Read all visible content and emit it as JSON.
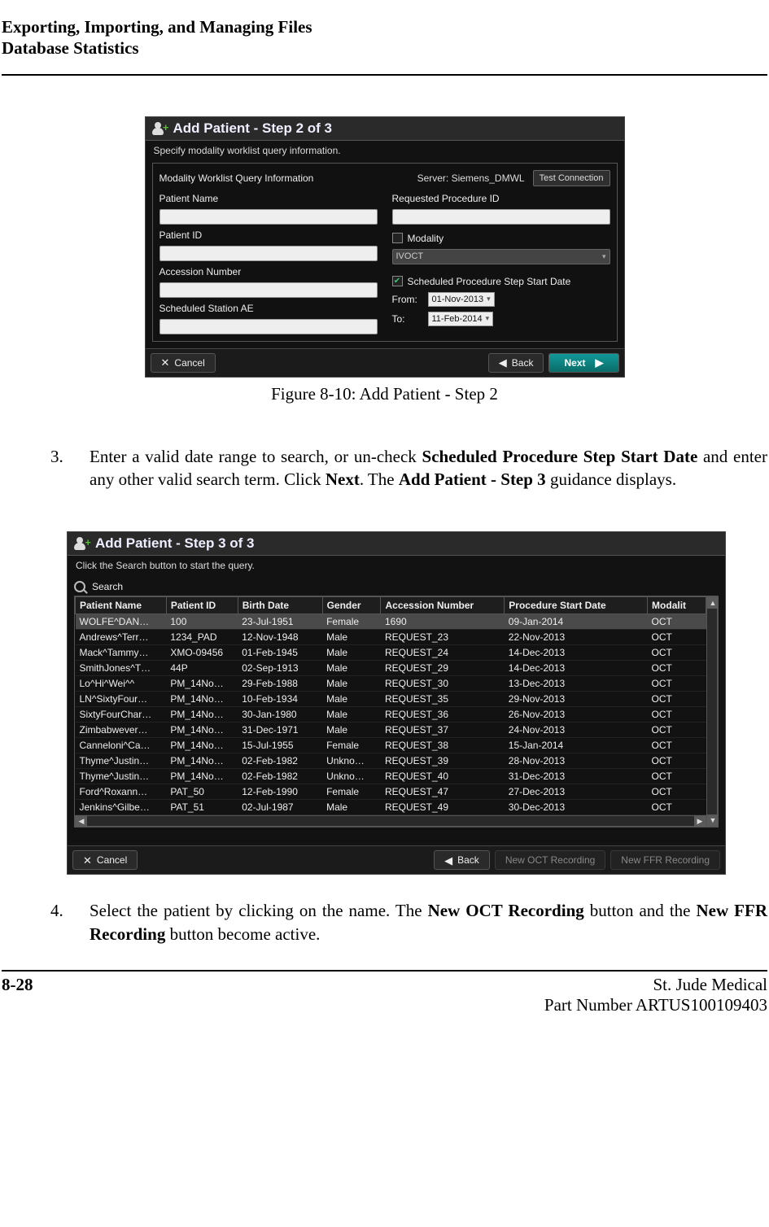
{
  "header": {
    "l1": "Exporting, Importing, and Managing Files",
    "l2": "Database Statistics"
  },
  "figure1": {
    "title": "Add Patient - Step 2 of 3",
    "subtitle": "Specify modality worklist query information.",
    "section": "Modality Worklist Query Information",
    "server": "Server: Siemens_DMWL",
    "test_connection": "Test Connection",
    "labels": {
      "patient_name": "Patient Name",
      "patient_id": "Patient ID",
      "accession": "Accession Number",
      "station_ae": "Scheduled Station AE",
      "req_proc": "Requested Procedure ID",
      "modality": "Modality",
      "modality_value": "IVOCT",
      "sched_date": "Scheduled Procedure Step Start Date",
      "from": "From:",
      "to": "To:",
      "from_val": "01-Nov-2013",
      "to_val": "11-Feb-2014"
    },
    "buttons": {
      "cancel": "Cancel",
      "back": "Back",
      "next": "Next"
    },
    "caption": "Figure 8-10:  Add Patient - Step 2"
  },
  "step3_text": {
    "num": "3.",
    "t1": "Enter a valid date range to search, or un-check ",
    "b1": "Scheduled Procedure Step Start Date",
    "t2": " and enter any other valid search term. Click ",
    "b2": "Next",
    "t3": ". The ",
    "b3": "Add Patient - Step 3",
    "t4": " guidance displays."
  },
  "figure2": {
    "title": "Add Patient - Step 3 of 3",
    "subtitle": "Click the Search button to start the query.",
    "search": "Search",
    "columns": [
      "Patient Name",
      "Patient ID",
      "Birth Date",
      "Gender",
      "Accession Number",
      "Procedure Start Date",
      "Modalit"
    ],
    "rows": [
      [
        "WOLFE^DAN…",
        "100",
        "23-Jul-1951",
        "Female",
        "1690",
        "09-Jan-2014",
        "OCT"
      ],
      [
        "Andrews^Terr…",
        "1234_PAD",
        "12-Nov-1948",
        "Male",
        "REQUEST_23",
        "22-Nov-2013",
        "OCT"
      ],
      [
        "Mack^Tammy…",
        "XMO-09456",
        "01-Feb-1945",
        "Male",
        "REQUEST_24",
        "14-Dec-2013",
        "OCT"
      ],
      [
        "SmithJones^T…",
        "44P",
        "02-Sep-1913",
        "Male",
        "REQUEST_29",
        "14-Dec-2013",
        "OCT"
      ],
      [
        "Lo^Hi^Wei^^",
        "PM_14No…",
        "29-Feb-1988",
        "Male",
        "REQUEST_30",
        "13-Dec-2013",
        "OCT"
      ],
      [
        "LN^SixtyFour…",
        "PM_14No…",
        "10-Feb-1934",
        "Male",
        "REQUEST_35",
        "29-Nov-2013",
        "OCT"
      ],
      [
        "SixtyFourChar…",
        "PM_14No…",
        "30-Jan-1980",
        "Male",
        "REQUEST_36",
        "26-Nov-2013",
        "OCT"
      ],
      [
        "Zimbabwever…",
        "PM_14No…",
        "31-Dec-1971",
        "Male",
        "REQUEST_37",
        "24-Nov-2013",
        "OCT"
      ],
      [
        "Canneloni^Ca…",
        "PM_14No…",
        "15-Jul-1955",
        "Female",
        "REQUEST_38",
        "15-Jan-2014",
        "OCT"
      ],
      [
        "Thyme^Justin…",
        "PM_14No…",
        "02-Feb-1982",
        "Unkno…",
        "REQUEST_39",
        "28-Nov-2013",
        "OCT"
      ],
      [
        "Thyme^Justin…",
        "PM_14No…",
        "02-Feb-1982",
        "Unkno…",
        "REQUEST_40",
        "31-Dec-2013",
        "OCT"
      ],
      [
        "Ford^Roxann…",
        "PAT_50",
        "12-Feb-1990",
        "Female",
        "REQUEST_47",
        "27-Dec-2013",
        "OCT"
      ],
      [
        "Jenkins^Gilbe…",
        "PAT_51",
        "02-Jul-1987",
        "Male",
        "REQUEST_49",
        "30-Dec-2013",
        "OCT"
      ]
    ],
    "buttons": {
      "cancel": "Cancel",
      "back": "Back",
      "new_oct": "New OCT Recording",
      "new_ffr": "New FFR Recording"
    }
  },
  "step4_text": {
    "num": "4.",
    "t1": "Select the patient by clicking on the name. The ",
    "b1": "New OCT Recording",
    "t2": " button and the ",
    "b2": "New FFR Recording",
    "t3": " button become active."
  },
  "footer": {
    "page": "8-28",
    "company": "St. Jude Medical",
    "part": "Part Number ARTUS100109403"
  }
}
